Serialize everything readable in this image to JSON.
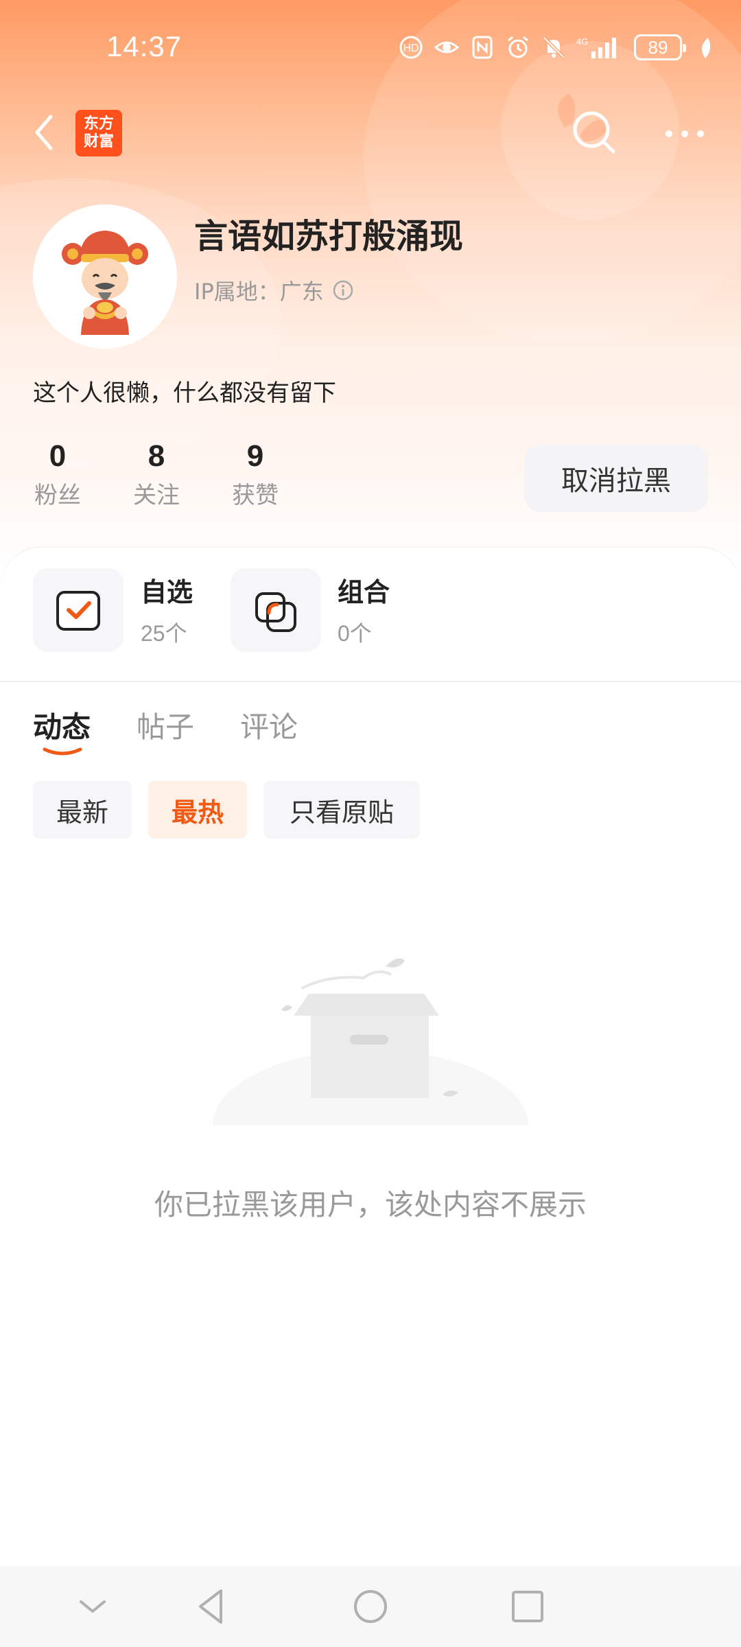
{
  "status_bar": {
    "time": "14:37",
    "battery": "89",
    "network": "4G",
    "icons": [
      "hd-call-icon",
      "eye-icon",
      "nfc-icon",
      "alarm-icon",
      "mute-icon",
      "network-4g-icon",
      "signal-icon",
      "battery-icon",
      "leaf-icon"
    ]
  },
  "nav": {
    "logo_line1": "东方",
    "logo_line2": "财富",
    "back_icon": "chevron-left-icon",
    "search_icon": "search-icon",
    "more_icon": "more-dots-icon"
  },
  "profile": {
    "username": "言语如苏打般涌现",
    "ip_location": "IP属地：广东",
    "bio": "这个人很懒，什么都没有留下",
    "stats": [
      {
        "num": "0",
        "label": "粉丝"
      },
      {
        "num": "8",
        "label": "关注"
      },
      {
        "num": "9",
        "label": "获赞"
      }
    ],
    "unblock_button": "取消拉黑"
  },
  "tiles": [
    {
      "title": "自选",
      "sub": "25个",
      "icon": "watchlist-check-icon"
    },
    {
      "title": "组合",
      "sub": "0个",
      "icon": "portfolio-icon"
    }
  ],
  "tabs": [
    {
      "label": "动态",
      "active": true
    },
    {
      "label": "帖子",
      "active": false
    },
    {
      "label": "评论",
      "active": false
    }
  ],
  "filters": [
    {
      "label": "最新",
      "active": false
    },
    {
      "label": "最热",
      "active": true
    },
    {
      "label": "只看原贴",
      "active": false
    }
  ],
  "empty_state": {
    "message": "你已拉黑该用户，该处内容不展示",
    "icon": "empty-box-icon"
  },
  "system_nav": [
    "collapse-icon",
    "back-triangle-icon",
    "home-circle-icon",
    "recents-square-icon"
  ],
  "colors": {
    "accent": "#f15a15",
    "logo": "#ff4f1a",
    "header_gradient_top": "#ff9a63"
  }
}
